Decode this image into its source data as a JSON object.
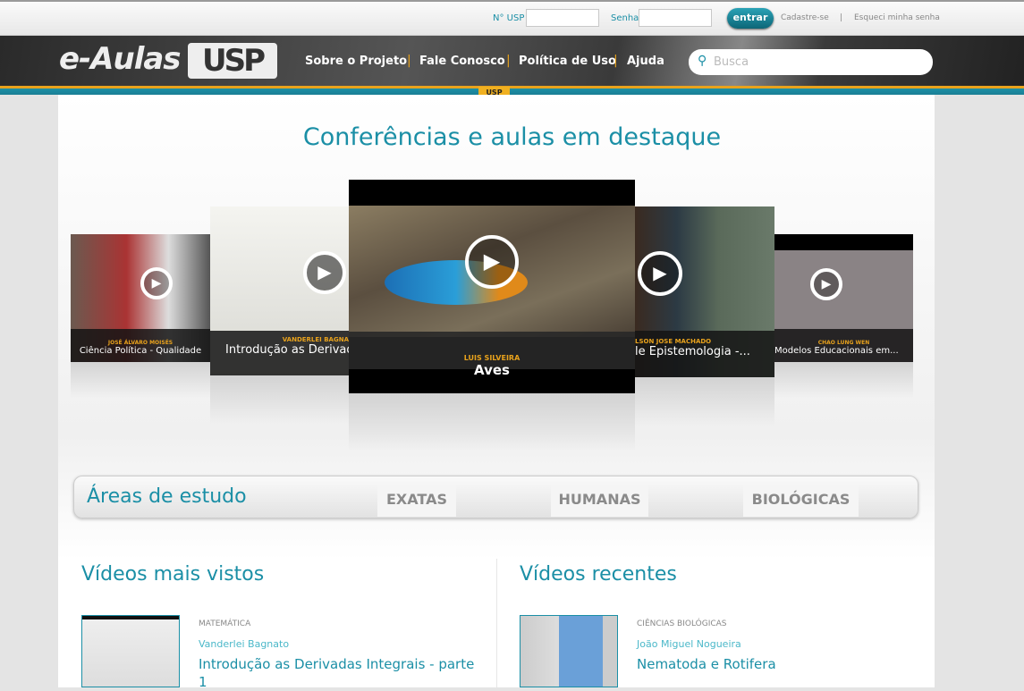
{
  "login": {
    "usp_label": "N° USP",
    "usp_value": "",
    "password_label": "Senha",
    "password_value": "",
    "submit": "entrar",
    "register": "Cadastre-se",
    "separator": "|",
    "forgot": "Esqueci minha senha"
  },
  "header": {
    "logo_text": "e-Aulas",
    "logo_mark": "USP",
    "nav": [
      "Sobre o Projeto",
      "Fale Conosco",
      "Política de Uso",
      "Ajuda"
    ],
    "search_placeholder": "Busca",
    "tag": "USP"
  },
  "featured": {
    "title": "Conferências e aulas em destaque",
    "items": [
      {
        "author": "JOSÉ ÁLVARO MOISÉS",
        "title": "Ciência Política - Qualidade"
      },
      {
        "author": "VANDERLEI BAGNA",
        "title": "Introdução as Derivada"
      },
      {
        "author": "LUIS SILVEIRA",
        "title": "Aves"
      },
      {
        "author": "LSON JOSE MACHADO",
        "title": "le Epistemologia -..."
      },
      {
        "author": "CHAO LUNG WEN",
        "title": "Modelos Educacionais em..."
      }
    ]
  },
  "areas": {
    "title": "Áreas de estudo",
    "buttons": [
      "EXATAS",
      "HUMANAS",
      "BIOLÓGICAS"
    ]
  },
  "most_viewed": {
    "title": "Vídeos mais vistos",
    "items": [
      {
        "category": "MATEMÁTICA",
        "author": "Vanderlei Bagnato",
        "title": "Introdução as Derivadas Integrais - parte 1"
      }
    ]
  },
  "recent": {
    "title": "Vídeos recentes",
    "items": [
      {
        "category": "CIÊNCIAS BIOLÓGICAS",
        "author": "João Miguel Nogueira",
        "title": "Nematoda e Rotifera"
      }
    ]
  },
  "colors": {
    "accent": "#1b8fa6",
    "highlight": "#e8a21c"
  }
}
